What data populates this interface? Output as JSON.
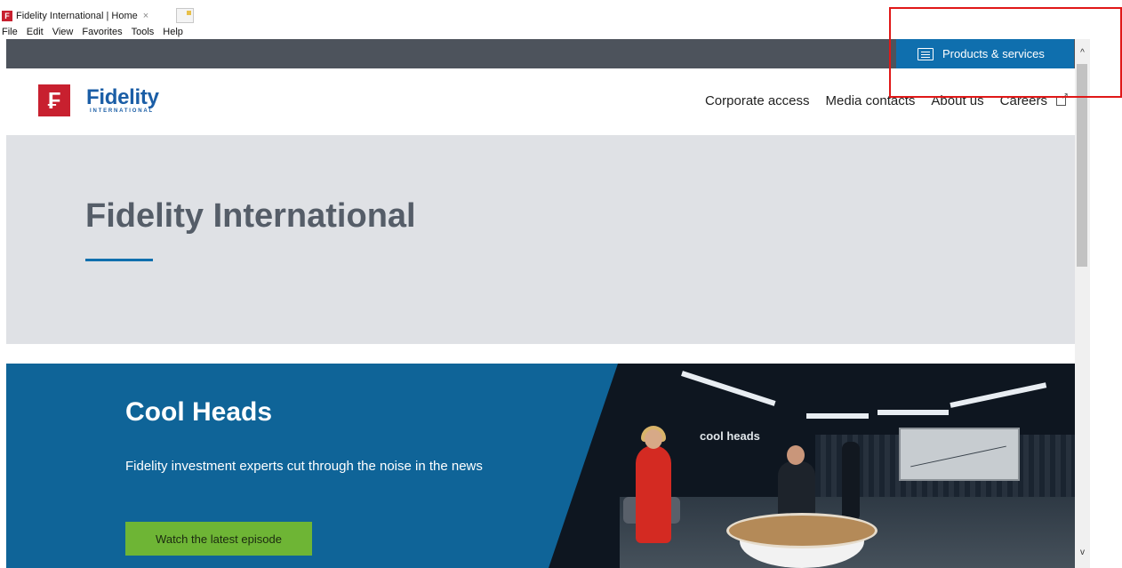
{
  "browser": {
    "tab_title": "Fidelity International | Home",
    "tab_close": "×",
    "favicon_letter": "F",
    "menu": [
      "File",
      "Edit",
      "View",
      "Favorites",
      "Tools",
      "Help"
    ]
  },
  "topbar": {
    "products_label": "Products & services",
    "products_icon": "document-list-icon"
  },
  "header": {
    "logo_mark": "₣",
    "logo_word": "Fidelity",
    "logo_sub": "INTERNATIONAL",
    "nav": [
      "Corporate access",
      "Media contacts",
      "About us",
      "Careers"
    ],
    "careers_icon": "external-link-icon"
  },
  "hero": {
    "title": "Fidelity International"
  },
  "promo": {
    "title": "Cool Heads",
    "text": "Fidelity investment experts cut through the noise in the news",
    "button": "Watch the latest episode",
    "studio_label": "cool heads"
  },
  "scrollbar": {
    "up": "^",
    "down": "v"
  },
  "colors": {
    "brand_red": "#c8202f",
    "brand_blue": "#1b5ea6",
    "promo_blue": "#0f6498",
    "products_blue": "#0f6fae",
    "cta_green": "#6eb535",
    "highlight": "#e01818"
  }
}
